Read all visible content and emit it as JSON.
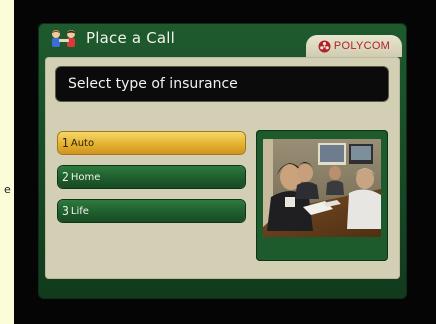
{
  "page": {
    "left_edge_char": "e"
  },
  "header": {
    "title": "Place a Call",
    "icon": "people-call-icon",
    "brand": "POLYCOM",
    "brand_icon": "polycom-logo-icon"
  },
  "prompt": {
    "text": "Select type of insurance"
  },
  "options": [
    {
      "number": "1",
      "label": "Auto",
      "selected": true
    },
    {
      "number": "2",
      "label": "Home",
      "selected": false
    },
    {
      "number": "3",
      "label": "Life",
      "selected": false
    }
  ],
  "preview": {
    "image_name": "conference-room-video-preview"
  },
  "colors": {
    "frame_green": "#1f5a2e",
    "panel_beige": "#d3cfb4",
    "selected_gold": "#e5b231",
    "brand_red": "#b3202a",
    "background": "#fdfcd9"
  }
}
